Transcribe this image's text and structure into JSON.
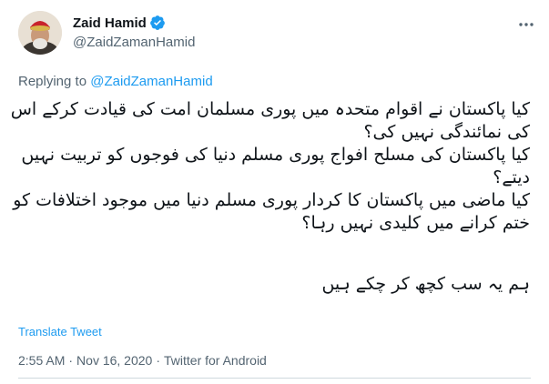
{
  "author": {
    "display_name": "Zaid Hamid",
    "handle": "@ZaidZamanHamid",
    "verified": true
  },
  "reply": {
    "prefix": "Replying to",
    "target": "@ZaidZamanHamid"
  },
  "tweet": {
    "lines": [
      "کیا پاکستان نے اقوام متحدہ میں پوری مسلمان امت کی قیادت کرکے اس",
      "کی نمائندگی نہیں کی؟",
      "کیا پاکستان کی مسلح افواج پوری مسلم دنیا کی فوجوں کو تربیت نہیں",
      "دیتے؟",
      "کیا ماضی میں پاکستان کا کردار پوری مسلم دنیا میں موجود اختلافات کو",
      "ختم کرانے میں کلیدی نہیں رہا؟",
      "ہم یہ سب کچھ کر چکے ہیں"
    ]
  },
  "translate_label": "Translate Tweet",
  "meta": {
    "time": "2:55 AM",
    "date": "Nov 16, 2020",
    "source": "Twitter for Android",
    "separator": "·"
  },
  "colors": {
    "accent": "#1d9bf0",
    "secondary_text": "#536471",
    "primary_text": "#0f1419"
  }
}
